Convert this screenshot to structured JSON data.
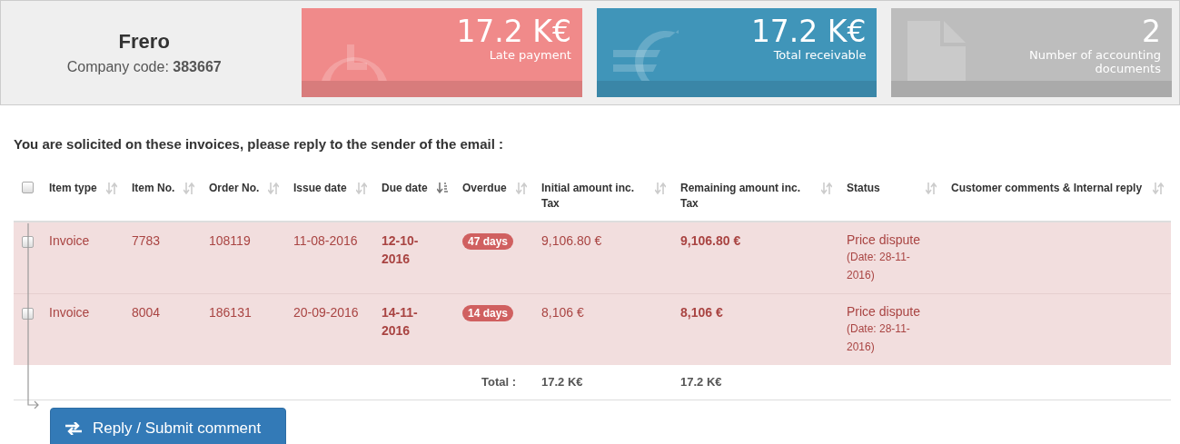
{
  "company": {
    "name": "Frero",
    "code_label": "Company code:",
    "code": "383667"
  },
  "cards": [
    {
      "kind": "clock",
      "value": "17.2 K€",
      "label": "Late payment",
      "color": "#f08a8a"
    },
    {
      "kind": "euro",
      "value": "17.2 K€",
      "label": "Total receivable",
      "color": "#4095b9"
    },
    {
      "kind": "document",
      "value": "2",
      "label": "Number of accounting documents",
      "color": "#bdbdbd"
    }
  ],
  "heading": "You are solicited on these invoices, please reply to the sender of the email :",
  "table": {
    "select_all": {
      "checked": false
    },
    "columns": [
      {
        "label": "Item type",
        "sorted": false
      },
      {
        "label": "Item No.",
        "sorted": false
      },
      {
        "label": "Order No.",
        "sorted": false
      },
      {
        "label": "Issue date",
        "sorted": false
      },
      {
        "label": "Due date",
        "sorted": true
      },
      {
        "label": "Overdue",
        "sorted": false
      },
      {
        "label": "Initial amount inc. Tax",
        "sorted": false
      },
      {
        "label": "Remaining amount inc. Tax",
        "sorted": false
      },
      {
        "label": "Status",
        "sorted": false
      },
      {
        "label": "Customer comments & Internal reply",
        "sorted": false
      }
    ],
    "rows": [
      {
        "checked": false,
        "highlighted": true,
        "item_type": "Invoice",
        "item_no": "7783",
        "order_no": "108119",
        "issue_date": "11-08-2016",
        "due_date": "12-10-2016",
        "overdue": "47 days",
        "initial_amount": "9,106.80 €",
        "remaining_amount": "9,106.80 €",
        "status": "Price dispute",
        "status_date": "(Date: 28-11-2016)"
      },
      {
        "checked": false,
        "highlighted": true,
        "item_type": "Invoice",
        "item_no": "8004",
        "order_no": "186131",
        "issue_date": "20-09-2016",
        "due_date": "14-11-2016",
        "overdue": "14 days",
        "initial_amount": "8,106 €",
        "remaining_amount": "8,106 €",
        "status": "Price dispute",
        "status_date": "(Date: 28-11-2016)"
      }
    ],
    "total": {
      "label": "Total :",
      "initial": "17.2 K€",
      "remaining": "17.2 K€"
    }
  },
  "button": "Reply / Submit comment"
}
